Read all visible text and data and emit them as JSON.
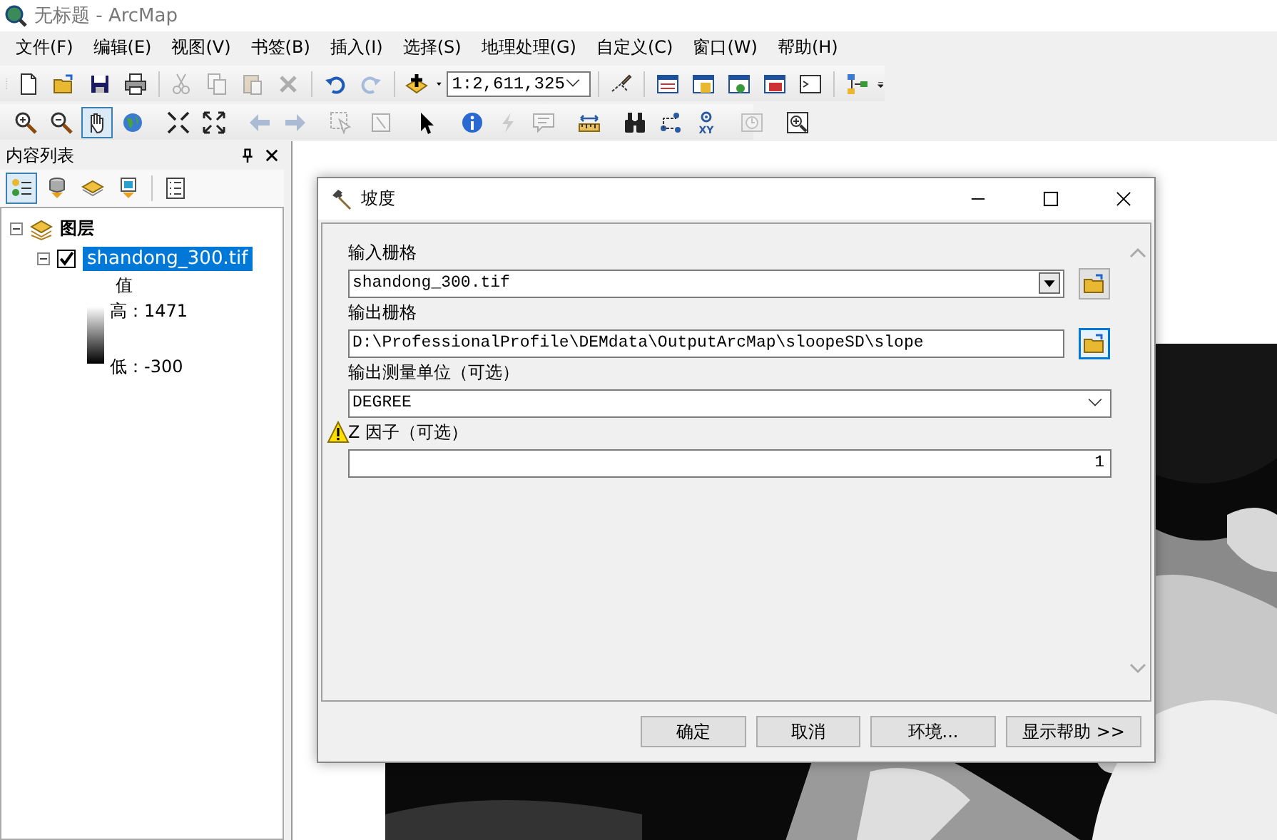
{
  "window": {
    "title": "无标题 - ArcMap"
  },
  "menu": [
    "文件(F)",
    "编辑(E)",
    "视图(V)",
    "书签(B)",
    "插入(I)",
    "选择(S)",
    "地理处理(G)",
    "自定义(C)",
    "窗口(W)",
    "帮助(H)"
  ],
  "toolbar_1": {
    "groups": [
      {
        "items": [
          {
            "kind": "new",
            "disabled": false
          },
          {
            "kind": "open",
            "disabled": false
          },
          {
            "kind": "save",
            "disabled": false
          },
          {
            "kind": "print",
            "disabled": false
          }
        ]
      },
      {
        "items": [
          {
            "kind": "cut",
            "disabled": true
          },
          {
            "kind": "copy",
            "disabled": true
          },
          {
            "kind": "paste",
            "disabled": true
          },
          {
            "kind": "delete",
            "disabled": true
          }
        ]
      },
      {
        "items": [
          {
            "kind": "undo",
            "disabled": false
          },
          {
            "kind": "redo",
            "disabled": true
          }
        ]
      },
      {
        "items": [
          {
            "kind": "add-data",
            "disabled": false
          },
          {
            "kind": "scale",
            "value": "1:2,611,325",
            "disabled": false
          }
        ]
      },
      {
        "items": [
          {
            "kind": "editor",
            "disabled": false
          }
        ]
      },
      {
        "items": [
          {
            "kind": "toc-window",
            "disabled": false
          },
          {
            "kind": "catalog",
            "disabled": false
          },
          {
            "kind": "search-window",
            "disabled": false
          },
          {
            "kind": "toolbox",
            "disabled": false
          },
          {
            "kind": "python",
            "disabled": false
          }
        ]
      },
      {
        "items": [
          {
            "kind": "model",
            "disabled": false
          }
        ]
      }
    ]
  },
  "toolbar_2": {
    "groups": [
      {
        "items": [
          {
            "kind": "zoom-in",
            "disabled": false,
            "selected": false
          },
          {
            "kind": "zoom-out",
            "disabled": false,
            "selected": false
          },
          {
            "kind": "pan",
            "disabled": false,
            "selected": true
          },
          {
            "kind": "globe",
            "disabled": false,
            "selected": false
          }
        ]
      },
      {
        "items": [
          {
            "kind": "fixed-in",
            "disabled": false,
            "selected": false
          },
          {
            "kind": "fixed-out",
            "disabled": false,
            "selected": false
          }
        ]
      },
      {
        "items": [
          {
            "kind": "back",
            "disabled": true,
            "selected": false
          },
          {
            "kind": "forward",
            "disabled": true,
            "selected": false
          }
        ]
      },
      {
        "items": [
          {
            "kind": "select",
            "disabled": true,
            "selected": false
          },
          {
            "kind": "clear",
            "disabled": true,
            "selected": false
          }
        ]
      },
      {
        "items": [
          {
            "kind": "pointer",
            "disabled": false,
            "selected": false
          }
        ]
      },
      {
        "items": [
          {
            "kind": "identify",
            "disabled": false,
            "selected": false
          },
          {
            "kind": "hyperlink",
            "disabled": true,
            "selected": false
          },
          {
            "kind": "popup",
            "disabled": true,
            "selected": false
          }
        ]
      },
      {
        "items": [
          {
            "kind": "measure",
            "disabled": false,
            "selected": false
          }
        ]
      },
      {
        "items": [
          {
            "kind": "find",
            "disabled": false,
            "selected": false
          },
          {
            "kind": "route",
            "disabled": false,
            "selected": false
          },
          {
            "kind": "goto-xy",
            "label": "XY",
            "disabled": false,
            "selected": false
          }
        ]
      },
      {
        "items": [
          {
            "kind": "time",
            "disabled": true,
            "selected": false
          }
        ]
      },
      {
        "items": [
          {
            "kind": "magnifier",
            "disabled": false,
            "selected": false
          }
        ]
      }
    ]
  },
  "toc": {
    "title": "内容列表",
    "tools": [
      {
        "kind": "drawing-order",
        "selected": true
      },
      {
        "kind": "source",
        "selected": false
      },
      {
        "kind": "visibility",
        "selected": false
      },
      {
        "kind": "selection",
        "selected": false
      },
      {
        "kind": "options",
        "selected": false
      }
    ],
    "tree": [
      {
        "label": "图层",
        "expanded": true,
        "children": [
          {
            "label": "shandong_300.tif",
            "expanded": true,
            "checked": true,
            "selected": true,
            "legend": {
              "heading": "值",
              "high": "高：1471",
              "low": "低：-300"
            }
          }
        ]
      }
    ]
  },
  "dialog": {
    "title": "坡度",
    "params": [
      {
        "label": "输入栅格",
        "kind": "combo",
        "value": "shandong_300.tif",
        "browse": true,
        "focused": false,
        "warning": false
      },
      {
        "label": "输出栅格",
        "kind": "text",
        "value": "D:\\ProfessionalProfile\\DEMdata\\OutputArcMap\\sloopeSD\\slope",
        "browse": true,
        "focused": true,
        "warning": false
      },
      {
        "label": "输出测量单位（可选）",
        "kind": "select",
        "value": "DEGREE",
        "browse": false,
        "warning": false
      },
      {
        "label": "Z 因子（可选）",
        "kind": "number",
        "value": "1",
        "browse": false,
        "warning": true
      }
    ],
    "buttons": [
      "确定",
      "取消",
      "环境...",
      "显示帮助 >>"
    ]
  }
}
